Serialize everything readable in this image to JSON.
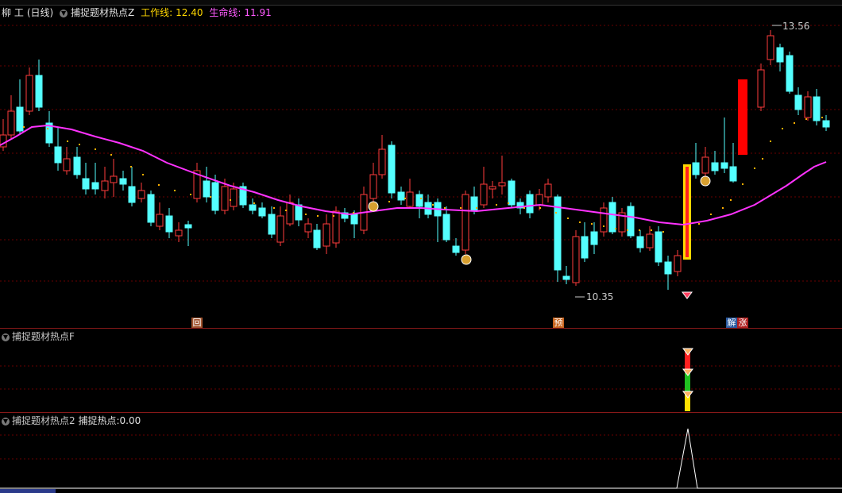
{
  "main_panel": {
    "stock_name": "柳  工",
    "period": "(日线)",
    "indicator_name": "捕捉题材热点Z",
    "work_line_label": "工作线:",
    "work_line_value": "12.40",
    "life_line_label": "生命线:",
    "life_line_value": "11.91",
    "high_label": "13.56",
    "low_label": "10.35",
    "markers": [
      {
        "text": "回",
        "bg": "#a0522d"
      },
      {
        "text": "预",
        "bg": "#c8641e"
      },
      {
        "text": "解",
        "bg": "#2a5aa0"
      },
      {
        "text": "涨",
        "bg": "#b01e1e"
      }
    ]
  },
  "panel2": {
    "indicator_name": "捕捉题材热点F"
  },
  "panel3": {
    "indicator_name": "捕捉题材热点2",
    "value_label": "捕捉热点:",
    "value": "0.00"
  },
  "colors": {
    "up": "#ff3c3c",
    "down": "#54ffff",
    "life_line": "#ff32ff",
    "work_dots": "#ffb000",
    "grid": "#6a0000",
    "label_yellow": "#ffd700",
    "label_magenta": "#ff5aff"
  },
  "chart_data": {
    "type": "candlestick",
    "title": "",
    "high_annotation": 13.56,
    "low_annotation": 10.35,
    "life_line_last": 11.91,
    "work_line_last": 12.4
  }
}
